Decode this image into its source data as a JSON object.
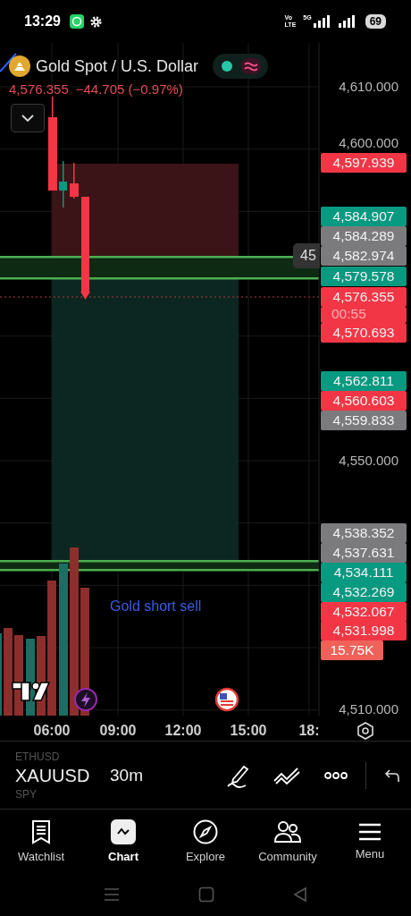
{
  "status_bar": {
    "time": "13:29",
    "network_lines": [
      "Vo",
      "LTE"
    ],
    "network_type": "5G",
    "battery": "69"
  },
  "header": {
    "title": "Gold Spot / U.S. Dollar",
    "price": "4,576.355",
    "change": "−44.705 (−0.97%)",
    "market_open": true
  },
  "chart": {
    "price_axis": [
      "4,610.000",
      "4,600.000",
      "4,550.000",
      "4,510.000"
    ],
    "price_tags": [
      {
        "value": "4,597.939",
        "color": "#f23645"
      },
      {
        "value": "4,584.907",
        "color": "#089981"
      },
      {
        "value": "4,584.289",
        "color": "#7b7b7e"
      },
      {
        "value": "4,582.974",
        "color": "#7b7b7e"
      },
      {
        "value": "4,579.578",
        "color": "#089981"
      },
      {
        "value": "4,576.355",
        "color": "#f23645",
        "countdown": "00:55"
      },
      {
        "value": "4,570.693",
        "color": "#f23645"
      },
      {
        "value": "4,562.811",
        "color": "#089981"
      },
      {
        "value": "4,560.603",
        "color": "#f23645"
      },
      {
        "value": "4,559.833",
        "color": "#7b7b7e"
      },
      {
        "value": "4,538.352",
        "color": "#7b7b7e"
      },
      {
        "value": "4,537.631",
        "color": "#7b7b7e"
      },
      {
        "value": "4,534.111",
        "color": "#089981"
      },
      {
        "value": "4,532.269",
        "color": "#089981"
      },
      {
        "value": "4,532.067",
        "color": "#f23645"
      },
      {
        "value": "4,531.998",
        "color": "#f23645"
      }
    ],
    "volume_tag": "15.75K",
    "line_label": "45",
    "note": "Gold short sell",
    "time_axis": [
      "06:00",
      "09:00",
      "12:00",
      "15:00",
      "18:"
    ]
  },
  "toolbar": {
    "symbols": [
      {
        "label": "ETHUSD",
        "selected": false
      },
      {
        "label": "XAUUSD",
        "selected": true
      },
      {
        "label": "SPY",
        "selected": false
      }
    ],
    "interval": "30m"
  },
  "nav": [
    {
      "label": "Watchlist",
      "kind": "watchlist",
      "selected": false
    },
    {
      "label": "Chart",
      "kind": "chart",
      "selected": true
    },
    {
      "label": "Explore",
      "kind": "explore",
      "selected": false
    },
    {
      "label": "Community",
      "kind": "community",
      "selected": false
    },
    {
      "label": "Menu",
      "kind": "menu",
      "selected": false
    }
  ]
}
